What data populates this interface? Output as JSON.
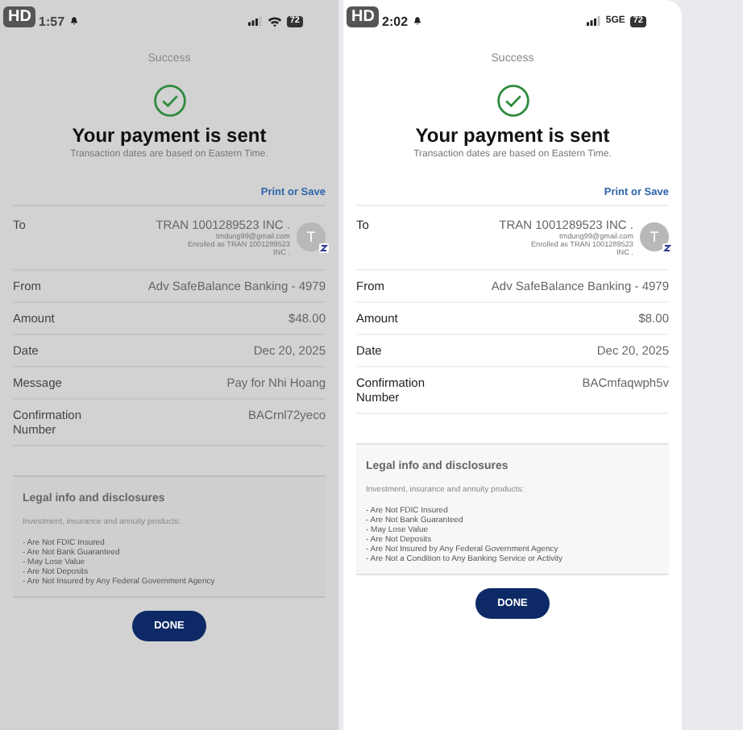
{
  "screens": [
    {
      "dimmed": true,
      "badge": "HD",
      "time": "1:57",
      "network": {
        "kind": "wifi"
      },
      "battery": "72",
      "header": "Success",
      "title": "Your payment is sent",
      "subtitle": "Transaction dates are based on Eastern Time.",
      "print_link": "Print or Save",
      "recipient": {
        "label": "To",
        "name": "TRAN 1001289523 INC .",
        "email": "tmdung99@gmail.com",
        "enrolled": "Enrolled as TRAN 1001289523 INC .",
        "avatar": "T"
      },
      "details": [
        {
          "label": "From",
          "value": "Adv SafeBalance Banking - 4979"
        },
        {
          "label": "Amount",
          "value": "$48.00"
        },
        {
          "label": "Date",
          "value": "Dec 20, 2025"
        },
        {
          "label": "Message",
          "value": "Pay for Nhi Hoang"
        },
        {
          "label": "Confirmation Number",
          "value": "BACrnl72yeco"
        }
      ],
      "legal": {
        "title": "Legal info and disclosures",
        "intro": "Investment, insurance and annuity products:",
        "bullets": [
          "- Are Not FDIC Insured",
          "- Are Not Bank Guaranteed",
          "- May Lose Value",
          "- Are Not Deposits",
          "- Are Not Insured by Any Federal Government Agency"
        ]
      },
      "done": "DONE"
    },
    {
      "dimmed": false,
      "badge": "HD",
      "time": "2:02",
      "network": {
        "kind": "text",
        "label": "5GE"
      },
      "battery": "72",
      "header": "Success",
      "title": "Your payment is sent",
      "subtitle": "Transaction dates are based on Eastern Time.",
      "print_link": "Print or Save",
      "recipient": {
        "label": "To",
        "name": "TRAN 1001289523 INC .",
        "email": "tmdung99@gmail.com",
        "enrolled": "Enrolled as TRAN 1001289523 INC .",
        "avatar": "T"
      },
      "details": [
        {
          "label": "From",
          "value": "Adv SafeBalance Banking - 4979"
        },
        {
          "label": "Amount",
          "value": "$8.00"
        },
        {
          "label": "Date",
          "value": "Dec 20, 2025"
        },
        {
          "label": "Confirmation Number",
          "value": "BACmfaqwph5v"
        }
      ],
      "legal": {
        "title": "Legal info and disclosures",
        "intro": "Investment, insurance and annuity products:",
        "bullets": [
          "- Are Not FDIC Insured",
          "- Are Not Bank Guaranteed",
          "- May Lose Value",
          "- Are Not Deposits",
          "- Are Not Insured by Any Federal Government Agency",
          "- Are Not a Condition to Any Banking Service or Activity"
        ]
      },
      "done": "DONE"
    }
  ]
}
